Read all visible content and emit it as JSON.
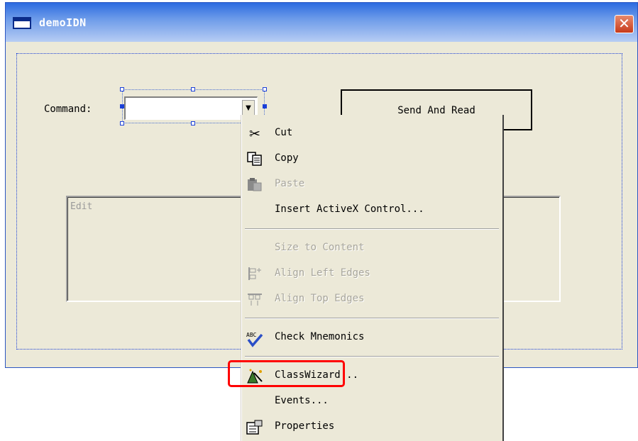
{
  "window": {
    "title": "demoIDN",
    "close_symbol": "✕"
  },
  "dialog": {
    "command_label": "Command:",
    "send_button_label": "Send And Read",
    "edit_placeholder": "Edit"
  },
  "context_menu": {
    "items": [
      {
        "label": "Cut",
        "icon": "scissors-icon",
        "enabled": true
      },
      {
        "label": "Copy",
        "icon": "copy-icon",
        "enabled": true
      },
      {
        "label": "Paste",
        "icon": "paste-icon",
        "enabled": false
      },
      {
        "label": "Insert ActiveX Control...",
        "icon": "",
        "enabled": true
      },
      {
        "label": "Size to Content",
        "icon": "",
        "enabled": false
      },
      {
        "label": "Align Left Edges",
        "icon": "align-left-icon",
        "enabled": false
      },
      {
        "label": "Align Top Edges",
        "icon": "align-top-icon",
        "enabled": false
      },
      {
        "label": "Check Mnemonics",
        "icon": "check-mnemonics-icon",
        "enabled": true
      },
      {
        "label": "ClassWizard...",
        "icon": "classwizard-icon",
        "enabled": true,
        "highlighted": true
      },
      {
        "label": "Events...",
        "icon": "",
        "enabled": true
      },
      {
        "label": "Properties",
        "icon": "properties-icon",
        "enabled": true
      }
    ]
  },
  "colors": {
    "titlebar": "#2d6be0",
    "window_bg": "#ece9d8",
    "highlight": "#ff0000",
    "selection": "#1a3fd8"
  }
}
